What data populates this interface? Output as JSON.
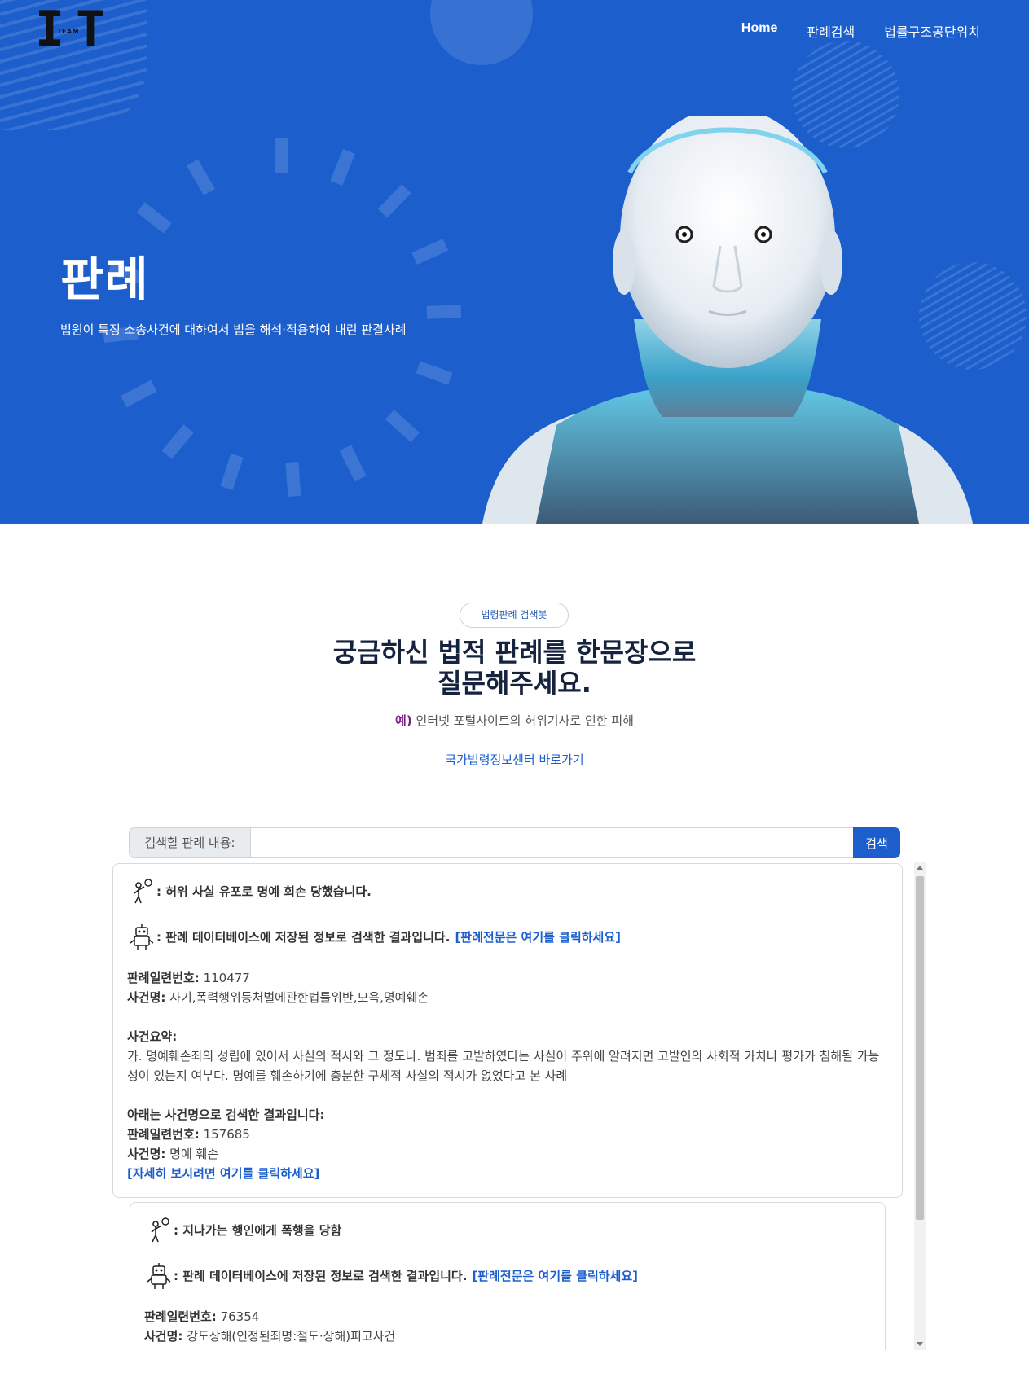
{
  "logo": {
    "big_i": "I",
    "big_t": "T",
    "small": "TEAM"
  },
  "nav": {
    "home": "Home",
    "search": "판례검색",
    "legal_aid": "법률구조공단위치"
  },
  "hero": {
    "title": "판례",
    "subtitle": "법원이 특정 소송사건에 대하여서 법을 해석·적용하여 내린 판결사례"
  },
  "intro": {
    "badge": "법령판례 검색봇",
    "headline_1": "궁금하신 법적 판례를 한문장으로",
    "headline_2": "질문해주세요.",
    "example_prefix": "예)",
    "example_text": " 인터넷 포털사이트의 허위기사로 인한 피해",
    "gov_link": "국가법령정보센터 바로가기"
  },
  "search": {
    "label": "검색할 판례 내용:",
    "value": "",
    "button": "검색"
  },
  "results": [
    {
      "question": ": 허위 사실 유포로 명예 회손 당했습니다.",
      "answer": ": 판례 데이터베이스에 저장된 정보로 검색한 결과입니다.",
      "answer_link": "[판례전문은 여기를 클릭하세요]",
      "serial_label": "판례일련번호:",
      "serial": " 110477",
      "case_label": "사건명:",
      "case_name": " 사기,폭력행위등처벌에관한법률위반,모욕,명예훼손",
      "summary_label": "사건요약:",
      "summary": "가. 명예훼손죄의 성립에 있어서 사실의 적시와 그 정도나. 범죄를 고발하였다는 사실이 주위에 알려지면 고발인의 사회적 가치나 평가가 침해될 가능성이 있는지 여부다. 명예를 훼손하기에 충분한 구체적 사실의 적시가 없었다고 본 사례",
      "by_name_label": "아래는 사건명으로 검색한 결과입니다:",
      "serial2_label": "판례일련번호:",
      "serial2": " 157685",
      "case2_label": "사건명:",
      "case2_name": " 명예 훼손",
      "detail_link": "[자세히 보시려면 여기를 클릭하세요]"
    },
    {
      "question": ": 지나가는 행인에게 폭행을 당함",
      "answer": ": 판례 데이터베이스에 저장된 정보로 검색한 결과입니다.",
      "answer_link": "[판례전문은 여기를 클릭하세요]",
      "serial_label": "판례일련번호:",
      "serial": " 76354",
      "case_label": "사건명:",
      "case_name": " 강도상해(인정된죄명:절도·상해)피고사건"
    }
  ],
  "icons": {
    "user": "user-question-icon",
    "bot": "robot-answer-icon"
  },
  "colors": {
    "hero_bg": "#1c5fcc",
    "accent": "#1c5fcc",
    "headline": "#16233f",
    "example_prefix": "#7a1f86"
  }
}
